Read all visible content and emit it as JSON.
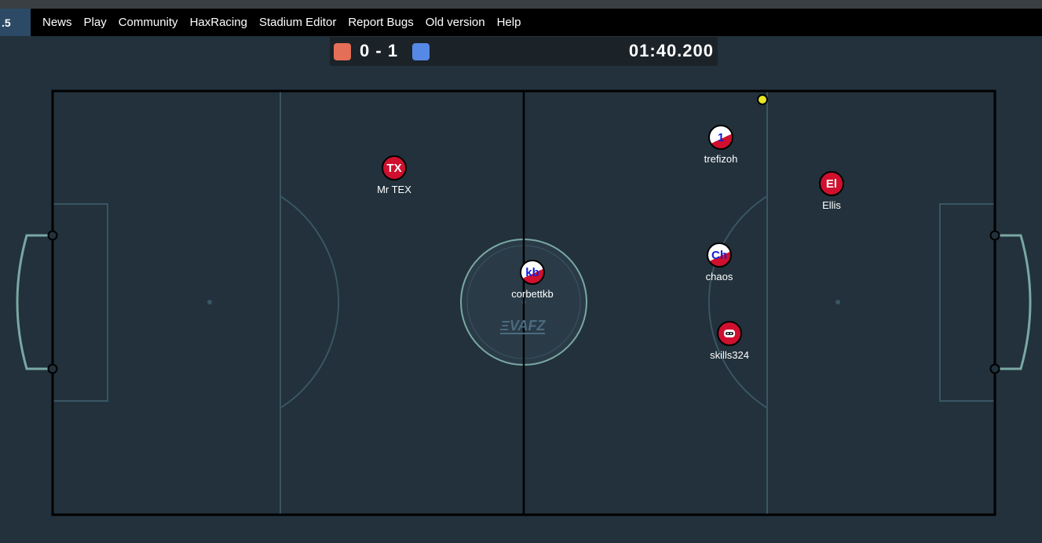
{
  "nav": {
    "version": ".5",
    "links": [
      "News",
      "Play",
      "Community",
      "HaxRacing",
      "Stadium Editor",
      "Report Bugs",
      "Old version",
      "Help"
    ]
  },
  "scoreboard": {
    "red_score": "0",
    "separator": "-",
    "blue_score": "1",
    "score_text": "0 - 1",
    "time": "01:40.200",
    "red_color": "#e56e56",
    "blue_color": "#5689e5"
  },
  "field": {
    "logo": "ΞVAFZ",
    "background": "#22313b",
    "line_color": "#3a5563",
    "goal_color": "#7aa8a4"
  },
  "players": [
    {
      "name": "Mr TEX",
      "avatar": "TX",
      "style": "red",
      "avatar_color": "w"
    },
    {
      "name": "trefizoh",
      "avatar": "1",
      "style": "white-red",
      "avatar_color": "b"
    },
    {
      "name": "Ellis",
      "avatar": "El",
      "style": "red",
      "avatar_color": "w"
    },
    {
      "name": "corbettkb",
      "avatar": "kb",
      "style": "white-red",
      "avatar_color": "b"
    },
    {
      "name": "chaos",
      "avatar": "Ch",
      "style": "white-red",
      "avatar_color": "b"
    },
    {
      "name": "skills324",
      "avatar": "robot-icon",
      "style": "red",
      "avatar_color": "w"
    }
  ],
  "ball_color": "#e6e624"
}
